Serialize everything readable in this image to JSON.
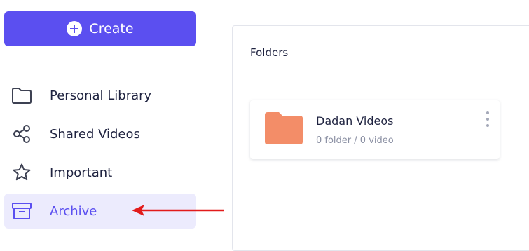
{
  "sidebar": {
    "create_label": "Create",
    "items": [
      {
        "label": "Personal Library",
        "icon": "folder-icon"
      },
      {
        "label": "Shared Videos",
        "icon": "share-icon"
      },
      {
        "label": "Important",
        "icon": "star-icon"
      },
      {
        "label": "Archive",
        "icon": "archive-icon",
        "active": true
      }
    ]
  },
  "main": {
    "section_title": "Folders",
    "folders": [
      {
        "name": "Dadan Videos",
        "meta": "0 folder / 0 video",
        "icon": "folder-icon"
      }
    ]
  },
  "colors": {
    "accent": "#5b4ff0",
    "active_bg": "#ecebfd",
    "folder": "#f38d68",
    "arrow": "#e21b1b"
  }
}
